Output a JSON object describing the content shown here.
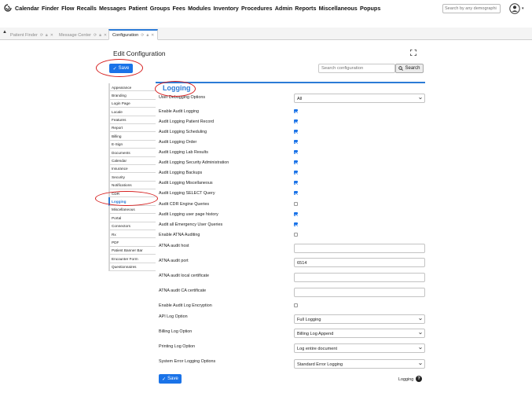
{
  "nav": {
    "menu": [
      "Calendar",
      "Finder",
      "Flow",
      "Recalls",
      "Messages",
      "Patient",
      "Groups",
      "Fees",
      "Modules",
      "Inventory",
      "Procedures",
      "Admin",
      "Reports",
      "Miscellaneous",
      "Popups"
    ],
    "search_placeholder": "Search by any demographi",
    "user_caret": "▾"
  },
  "tabs": [
    {
      "label": "Patient Finder"
    },
    {
      "label": "Message Center"
    },
    {
      "label": "Configuration"
    }
  ],
  "panel": {
    "title": "Edit Configuration",
    "save_label": "Save",
    "search_placeholder": "Search configuration",
    "search_button": "Search"
  },
  "sidebar": [
    "Appearance",
    "Branding",
    "Login Page",
    "Locale",
    "Features",
    "Report",
    "Billing",
    "E-Sign",
    "Documents",
    "Calendar",
    "Insurance",
    "Security",
    "Notifications",
    "CDR",
    "Logging",
    "Miscellaneous",
    "Portal",
    "Connectors",
    "Rx",
    "PDF",
    "Patient Banner Bar",
    "Encounter Form",
    "Questionnaires"
  ],
  "section": {
    "title": "Logging",
    "rows": [
      {
        "label": "User Debugging Options",
        "type": "select",
        "value": "All"
      },
      {
        "label": "Enable Audit Logging",
        "type": "check",
        "checked": true
      },
      {
        "label": "Audit Logging Patient Record",
        "type": "check",
        "checked": true
      },
      {
        "label": "Audit Logging Scheduling",
        "type": "check",
        "checked": true
      },
      {
        "label": "Audit Logging Order",
        "type": "check",
        "checked": true
      },
      {
        "label": "Audit Logging Lab Results",
        "type": "check",
        "checked": true
      },
      {
        "label": "Audit Logging Security Administration",
        "type": "check",
        "checked": true
      },
      {
        "label": "Audit Logging Backups",
        "type": "check",
        "checked": true
      },
      {
        "label": "Audit Logging Miscellaneous",
        "type": "check",
        "checked": true
      },
      {
        "label": "Audit Logging SELECT Query",
        "type": "check",
        "checked": true
      },
      {
        "label": "Audit CDR Engine Queries",
        "type": "check",
        "checked": false
      },
      {
        "label": "Audit Logging user page history",
        "type": "check",
        "checked": true
      },
      {
        "label": "Audit all Emergency User Queries",
        "type": "check",
        "checked": true
      },
      {
        "label": "Enable ATNA Auditing",
        "type": "check",
        "checked": false
      },
      {
        "label": "ATNA audit host",
        "type": "text",
        "value": ""
      },
      {
        "label": "ATNA audit port",
        "type": "text",
        "value": "6514"
      },
      {
        "label": "ATNA audit local certificate",
        "type": "text",
        "value": ""
      },
      {
        "label": "ATNA audit CA certificate",
        "type": "text",
        "value": ""
      },
      {
        "label": "Enable Audit Log Encryption",
        "type": "check",
        "checked": false
      },
      {
        "label": "API Log Option",
        "type": "select",
        "value": "Full Logging"
      },
      {
        "label": "Billing Log Option",
        "type": "select",
        "value": "Billing Log Append"
      },
      {
        "label": "Printing Log Option",
        "type": "select",
        "value": "Log entire document"
      },
      {
        "label": "System Error Logging Options",
        "type": "select",
        "value": "Standard Error Logging"
      }
    ]
  },
  "footer": {
    "save_label": "Save",
    "help_label": "Logging",
    "help_icon": "?"
  },
  "colors": {
    "accent": "#1a73e8",
    "highlight": "#d62020",
    "section": "#2b7bd6"
  }
}
